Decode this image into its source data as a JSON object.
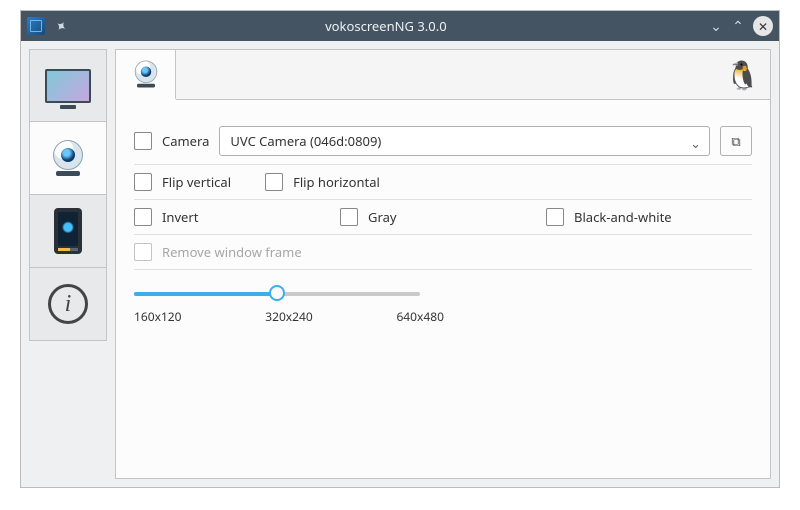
{
  "window": {
    "title": "vokoscreenNG 3.0.0"
  },
  "sidebar": {
    "items": [
      {
        "name": "screen"
      },
      {
        "name": "camera"
      },
      {
        "name": "phone"
      },
      {
        "name": "info"
      }
    ],
    "active_index": 1
  },
  "camera_panel": {
    "camera_label": "Camera",
    "camera_selected": "UVC Camera (046d:0809)",
    "flip_vertical_label": "Flip vertical",
    "flip_horizontal_label": "Flip horizontal",
    "invert_label": "Invert",
    "gray_label": "Gray",
    "bw_label": "Black-and-white",
    "remove_frame_label": "Remove window frame",
    "sizes": [
      "160x120",
      "320x240",
      "640x480"
    ],
    "size_selected_index": 1,
    "checks": {
      "camera": false,
      "flip_vertical": false,
      "flip_horizontal": false,
      "invert": false,
      "gray": false,
      "bw": false,
      "remove_frame": false
    },
    "remove_frame_enabled": false
  }
}
